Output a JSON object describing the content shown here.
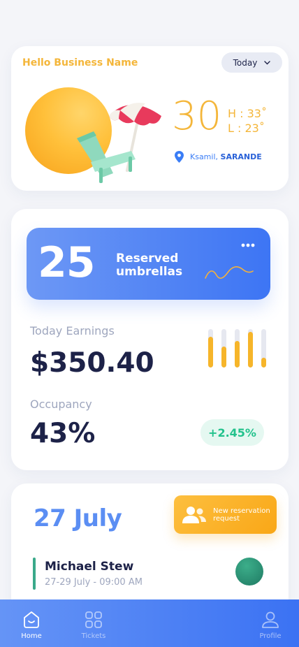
{
  "weather": {
    "greeting": "Hello Business Name",
    "period": "Today",
    "temperature": "30",
    "high": "H : 33˚",
    "low": "L : 23˚",
    "location_place": "Ksamil,",
    "location_city": "SARANDE",
    "icons": [
      "location-pin-icon",
      "chevron-down-icon"
    ]
  },
  "stats": {
    "reserved_count": "25",
    "reserved_label": "Reserved umbrellas",
    "earnings_label": "Today Earnings",
    "earnings_value": "$350.40",
    "occupancy_label": "Occupancy",
    "occupancy_value": "43%",
    "occupancy_change": "+2.45%",
    "bar_levels": [
      0.8,
      0.55,
      0.7,
      0.92,
      0.25
    ]
  },
  "schedule": {
    "date": "27 July",
    "new_request_label": "New reservation request",
    "reservations": [
      {
        "name": "Michael Stew",
        "dates": "27-29 July -  09:00 AM"
      }
    ]
  },
  "nav": {
    "items": [
      {
        "label": "Home",
        "icon": "home-icon",
        "active": true
      },
      {
        "label": "Tickets",
        "icon": "grid-icon",
        "active": false
      },
      {
        "label": "Profile",
        "icon": "profile-icon",
        "active": false
      }
    ]
  },
  "colors": {
    "accent_blue": "#3d75f4",
    "accent_yellow": "#f4b63a",
    "positive_green": "#22c28c",
    "text_dark": "#1d2248"
  }
}
